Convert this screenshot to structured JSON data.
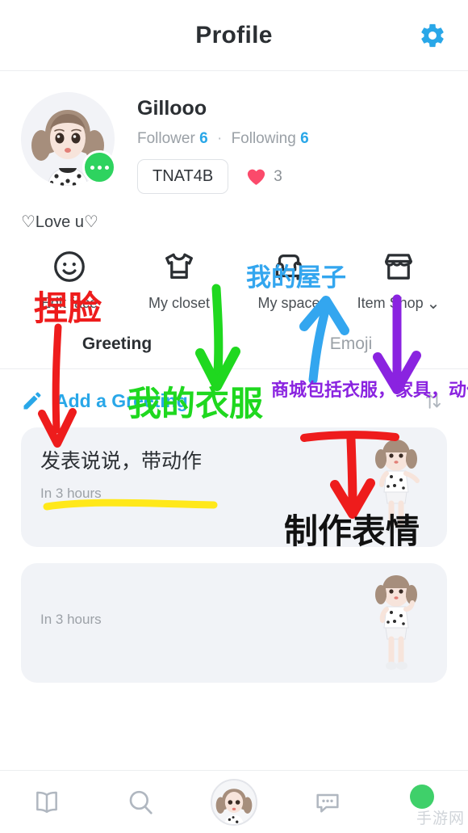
{
  "header": {
    "title": "Profile",
    "settings_icon": "gear-icon",
    "settings_color": "#29a7e8"
  },
  "profile": {
    "username": "Gillooo",
    "follower_label": "Follower",
    "follower_count": "6",
    "separator": "·",
    "following_label": "Following",
    "following_count": "6",
    "user_id": "TNAT4B",
    "heart_icon": "heart-icon",
    "heart_count": "3",
    "more_badge_icon": "ellipsis-icon",
    "status_text": "♡Love u♡"
  },
  "actions": [
    {
      "label": "Edit face",
      "icon": "face-icon",
      "chevron": ""
    },
    {
      "label": "My closet",
      "icon": "tshirt-icon",
      "chevron": ""
    },
    {
      "label": "My space",
      "icon": "armchair-icon",
      "chevron": ""
    },
    {
      "label": "Item Shop",
      "icon": "store-icon",
      "chevron": "⌄"
    }
  ],
  "tabs": [
    {
      "label": "Greeting",
      "active": true
    },
    {
      "label": "Emoji",
      "active": false
    }
  ],
  "greeting_bar": {
    "pencil_icon": "pencil-icon",
    "add_label": "Add a Greeting",
    "sort_icon": "sort-arrows-icon"
  },
  "cards": [
    {
      "text": "发表说说，带动作",
      "time": "In 3 hours"
    },
    {
      "text": "",
      "time": "In 3 hours"
    }
  ],
  "bottom_nav": [
    {
      "icon": "book-icon",
      "label": ""
    },
    {
      "icon": "search-icon",
      "label": ""
    },
    {
      "icon": "avatar-icon",
      "label": ""
    },
    {
      "icon": "chat-bubble-icon",
      "label": ""
    },
    {
      "icon": "profile-dot-icon",
      "label": ""
    }
  ],
  "watermark": {
    "text": "手游网"
  },
  "annotations": [
    {
      "id": "a1",
      "text": "捏脸",
      "color": "#ee1c1c",
      "note": "pinch face - points at Edit face"
    },
    {
      "id": "a2",
      "text": "我的屋子",
      "color": "#33a6ef",
      "note": "my house - points at My space"
    },
    {
      "id": "a3",
      "text": "我的衣服",
      "color": "#1fd81f",
      "note": "my clothes - points at My closet"
    },
    {
      "id": "a4",
      "text": "商城包括衣服，家具，动作",
      "color": "#8a23e0",
      "note": "shop includes clothes, furniture, actions"
    },
    {
      "id": "a5",
      "text": "制作表情",
      "color": "#111111",
      "note": "make emoji - points at Emoji tab"
    }
  ]
}
